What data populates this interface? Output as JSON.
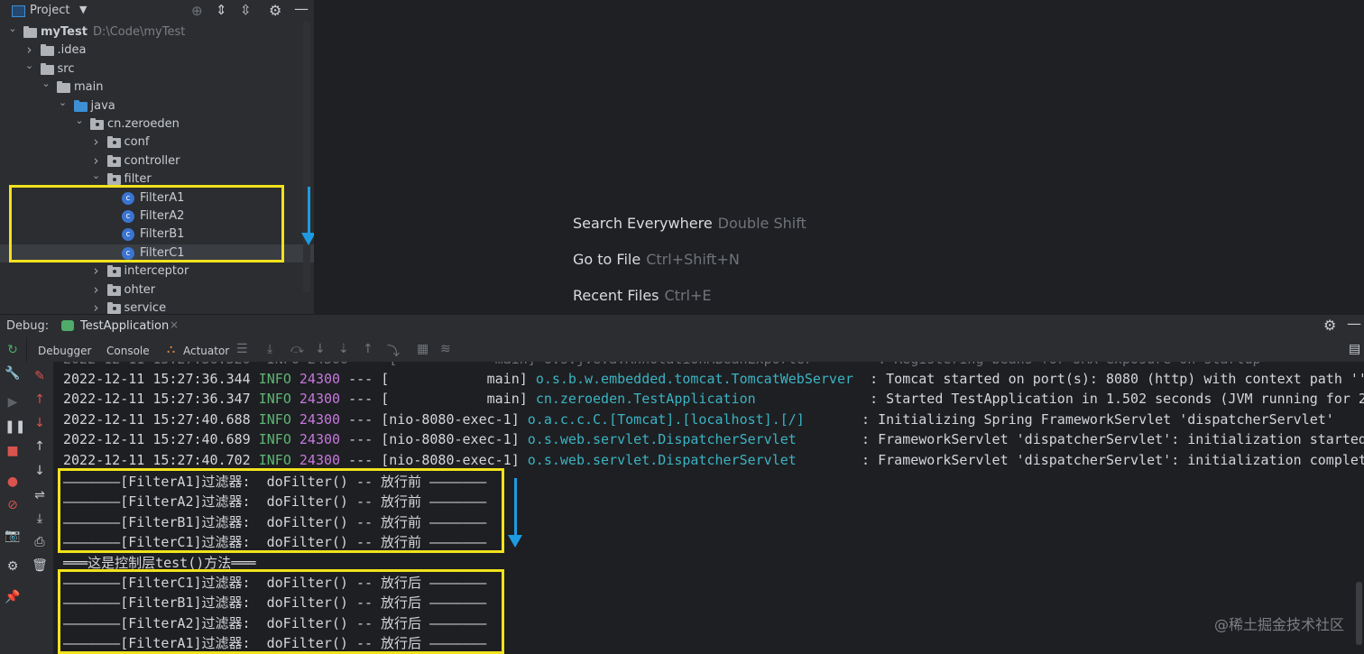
{
  "project": {
    "title": "Project",
    "tree": [
      {
        "label": "myTest",
        "sub": "D:\\Code\\myTest",
        "type": "module",
        "arrow": "down"
      },
      {
        "label": ".idea",
        "type": "folder",
        "arrow": "right"
      },
      {
        "label": "src",
        "type": "folder",
        "arrow": "down"
      },
      {
        "label": "main",
        "type": "folder",
        "arrow": "down"
      },
      {
        "label": "java",
        "type": "folder-blue",
        "arrow": "down"
      },
      {
        "label": "cn.zeroeden",
        "type": "package",
        "arrow": "down"
      },
      {
        "label": "conf",
        "type": "package",
        "arrow": "right"
      },
      {
        "label": "controller",
        "type": "package",
        "arrow": "right"
      },
      {
        "label": "filter",
        "type": "package",
        "arrow": "down"
      },
      {
        "label": "FilterA1",
        "type": "class"
      },
      {
        "label": "FilterA2",
        "type": "class"
      },
      {
        "label": "FilterB1",
        "type": "class"
      },
      {
        "label": "FilterC1",
        "type": "class"
      },
      {
        "label": "interceptor",
        "type": "package",
        "arrow": "right"
      },
      {
        "label": "ohter",
        "type": "package",
        "arrow": "right"
      },
      {
        "label": "service",
        "type": "package",
        "arrow": "right"
      }
    ]
  },
  "editor": {
    "hints": [
      {
        "action": "Search Everywhere",
        "shortcut": "Double Shift"
      },
      {
        "action": "Go to File",
        "shortcut": "Ctrl+Shift+N"
      },
      {
        "action": "Recent Files",
        "shortcut": "Ctrl+E"
      }
    ]
  },
  "debug": {
    "label": "Debug:",
    "tab": "TestApplication",
    "close": "×",
    "tabs": [
      "Debugger",
      "Console",
      "Actuator"
    ]
  },
  "console": {
    "log_lines": [
      {
        "ts": "2022-12-11 15:27:36.344",
        "level": "INFO",
        "pid": "24300",
        "sep": "---",
        "thread": "[            main]",
        "logger": "o.s.b.w.embedded.tomcat.TomcatWebServer ",
        "msg": " : Tomcat started on port(s): 8080 (http) with context path ''"
      },
      {
        "ts": "2022-12-11 15:27:36.347",
        "level": "INFO",
        "pid": "24300",
        "sep": "---",
        "thread": "[            main]",
        "logger": "cn.zeroeden.TestApplication             ",
        "msg": " : Started TestApplication in 1.502 seconds (JVM running for 2."
      },
      {
        "ts": "2022-12-11 15:27:40.688",
        "level": "INFO",
        "pid": "24300",
        "sep": "---",
        "thread": "[nio-8080-exec-1]",
        "logger": "o.a.c.c.C.[Tomcat].[localhost].[/]      ",
        "msg": " : Initializing Spring FrameworkServlet 'dispatcherServlet'"
      },
      {
        "ts": "2022-12-11 15:27:40.689",
        "level": "INFO",
        "pid": "24300",
        "sep": "---",
        "thread": "[nio-8080-exec-1]",
        "logger": "o.s.web.servlet.DispatcherServlet       ",
        "msg": " : FrameworkServlet 'dispatcherServlet': initialization started"
      },
      {
        "ts": "2022-12-11 15:27:40.702",
        "level": "INFO",
        "pid": "24300",
        "sep": "---",
        "thread": "[nio-8080-exec-1]",
        "logger": "o.s.web.servlet.DispatcherServlet       ",
        "msg": " : FrameworkServlet 'dispatcherServlet': initialization complet"
      }
    ],
    "filter_lines": [
      "———————[FilterA1]过滤器:  doFilter() -- 放行前 ———————",
      "———————[FilterA2]过滤器:  doFilter() -- 放行前 ———————",
      "———————[FilterB1]过滤器:  doFilter() -- 放行前 ———————",
      "———————[FilterC1]过滤器:  doFilter() -- 放行前 ———————",
      "═══这是控制层test()方法═══",
      "———————[FilterC1]过滤器:  doFilter() -- 放行后 ———————",
      "———————[FilterB1]过滤器:  doFilter() -- 放行后 ———————",
      "———————[FilterA2]过滤器:  doFilter() -- 放行后 ———————",
      "———————[FilterA1]过滤器:  doFilter() -- 放行后 ———————"
    ]
  },
  "watermark": "@稀土掘金技术社区",
  "colors": {
    "highlight_box": "#f2e21c",
    "arrow": "#1e9be0",
    "accent": "#3c7ce0"
  }
}
